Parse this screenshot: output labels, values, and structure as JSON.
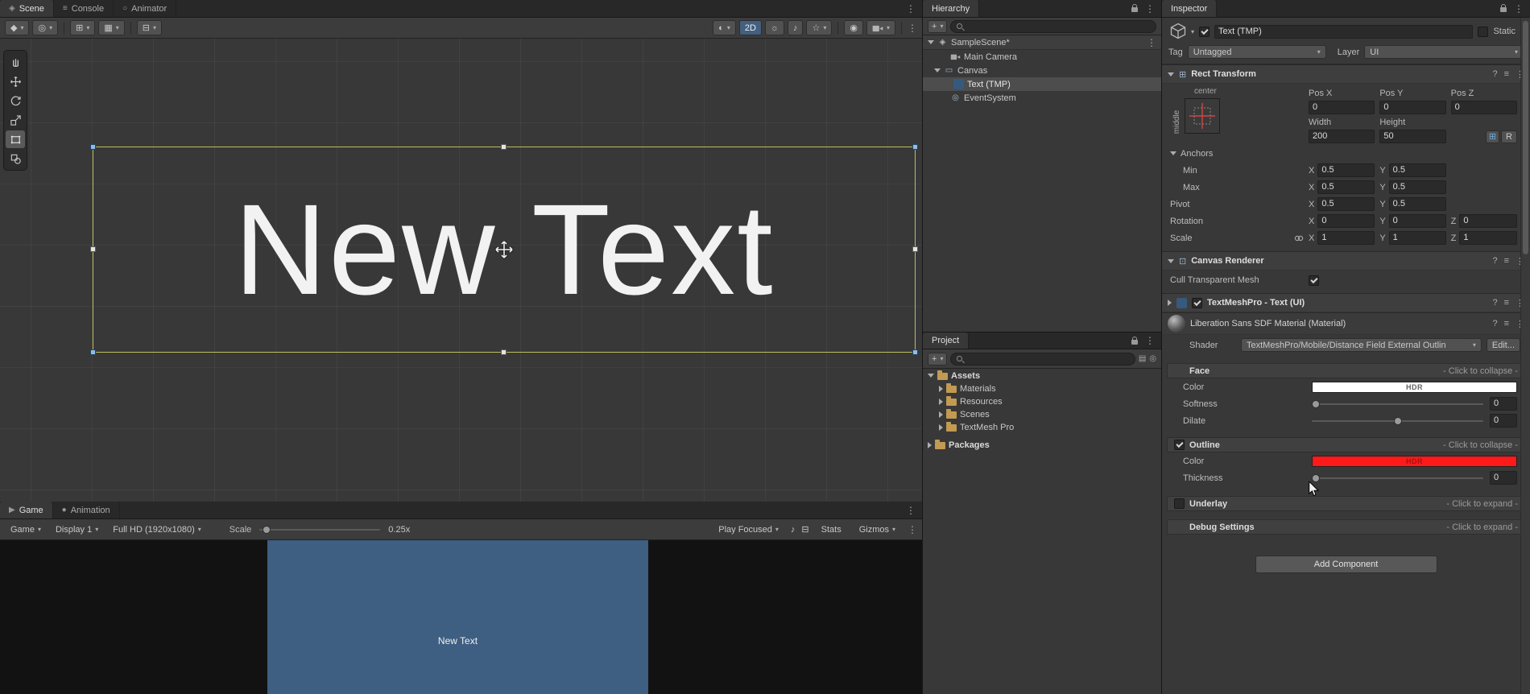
{
  "colors": {
    "selection_outline": "#BDBD5E",
    "face_color": "#FFFFFF",
    "outline_color": "#FF1A1A",
    "game_camera_bg": "#3E5E82",
    "active_toggle": "#44607F",
    "raycast_blue": "#6FA8DC"
  },
  "icons": {
    "caret": "▾",
    "caret_right": "▸",
    "menu": "⋮",
    "help": "?",
    "presets": "≡",
    "plus": "+",
    "tab_scene": "◈",
    "tab_console": "≡",
    "tab_animator": "○",
    "tab_game": "▶",
    "tab_animation": "●",
    "gizmo": "◆",
    "pivot": "◎",
    "grid": "⊞",
    "grid_snap": "▦",
    "snap": "⊟",
    "shading": "◐",
    "lighting": "☼",
    "audio": "♪",
    "effects": "☆",
    "visibility": "◉",
    "scene_object": "◈",
    "canvas_object": "▭",
    "event_object": "◎",
    "rect_transform": "⊞",
    "canvas_renderer": "⊡",
    "vsync": "⊟",
    "folder_extra": "▤",
    "eye_extra": "◎"
  },
  "scene_panel": {
    "tabs": {
      "scene": "Scene",
      "console": "Console",
      "animator": "Animator"
    },
    "toolbar": {
      "toggle_2d": "2D"
    },
    "canvas_text": "New Text"
  },
  "game_panel": {
    "tabs": {
      "game": "Game",
      "animation": "Animation"
    },
    "toolbar": {
      "mode": "Game",
      "display": "Display 1",
      "resolution": "Full HD (1920x1080)",
      "scale_label": "Scale",
      "scale_value": "0.25x",
      "play_focused": "Play Focused",
      "stats": "Stats",
      "gizmos": "Gizmos"
    },
    "view_text": "New Text"
  },
  "hierarchy": {
    "tab": "Hierarchy",
    "items": [
      {
        "label": "SampleScene*"
      },
      {
        "label": "Main Camera"
      },
      {
        "label": "Canvas"
      },
      {
        "label": "Text (TMP)"
      },
      {
        "label": "EventSystem"
      }
    ]
  },
  "project": {
    "tab": "Project",
    "items": [
      {
        "label": "Assets"
      },
      {
        "label": "Materials"
      },
      {
        "label": "Resources"
      },
      {
        "label": "Scenes"
      },
      {
        "label": "TextMesh Pro"
      },
      {
        "label": "Packages"
      }
    ]
  },
  "inspector": {
    "tab": "Inspector",
    "header": {
      "name": "Text (TMP)",
      "static_label": "Static",
      "tag_label": "Tag",
      "tag_value": "Untagged",
      "layer_label": "Layer",
      "layer_value": "UI"
    },
    "rect_transform": {
      "title": "Rect Transform",
      "anchor_h": "center",
      "anchor_v": "middle",
      "pos_x_label": "Pos X",
      "pos_x": "0",
      "pos_y_label": "Pos Y",
      "pos_y": "0",
      "pos_z_label": "Pos Z",
      "pos_z": "0",
      "width_label": "Width",
      "width": "200",
      "height_label": "Height",
      "height": "50",
      "raw_edit": "R",
      "anchors_title": "Anchors",
      "min_label": "Min",
      "min_x": "0.5",
      "min_y": "0.5",
      "max_label": "Max",
      "max_x": "0.5",
      "max_y": "0.5",
      "pivot_label": "Pivot",
      "pivot_x": "0.5",
      "pivot_y": "0.5",
      "rotation_label": "Rotation",
      "rot_x": "0",
      "rot_y": "0",
      "rot_z": "0",
      "scale_label": "Scale",
      "scale_x": "1",
      "scale_y": "1",
      "scale_z": "1",
      "axis_x": "X",
      "axis_y": "Y",
      "axis_z": "Z"
    },
    "canvas_renderer": {
      "title": "Canvas Renderer",
      "cull_label": "Cull Transparent Mesh"
    },
    "tmp_title": "TextMeshPro - Text (UI)",
    "material": {
      "title": "Liberation Sans SDF Material (Material)",
      "shader_label": "Shader",
      "shader_value": "TextMeshPro/Mobile/Distance Field External Outlin",
      "edit_label": "Edit...",
      "face": {
        "title": "Face",
        "state": "- Click to collapse -",
        "color_label": "Color",
        "hdr": "HDR",
        "softness_label": "Softness",
        "softness_value": "0",
        "dilate_label": "Dilate",
        "dilate_value": "0"
      },
      "outline": {
        "title": "Outline",
        "state": "- Click to collapse -",
        "color_label": "Color",
        "hdr": "HDR",
        "thickness_label": "Thickness",
        "thickness_value": "0"
      },
      "underlay": {
        "title": "Underlay",
        "state": "- Click to expand -"
      },
      "debug": {
        "title": "Debug Settings",
        "state": "- Click to expand -"
      }
    },
    "add_component": "Add Component"
  }
}
